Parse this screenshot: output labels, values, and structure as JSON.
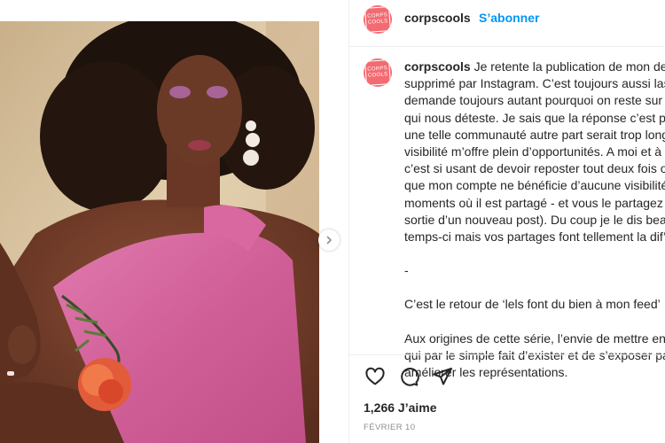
{
  "post": {
    "username": "corpscools",
    "follow_label": "S’abonner",
    "avatar_lines": [
      "CORPS",
      "COOLS"
    ],
    "caption_lines": [
      "Je retente la publication de mon derni",
      "supprimé par Instagram. C’est toujours aussi lassa",
      "demande toujours autant pourquoi on reste sur un",
      "qui nous déteste. Je sais que la réponse c’est parc",
      "une telle communauté autre part serait trop long e",
      "visibilité m’offre plein d’opportunités. A moi et à l’a",
      "c’est si usant de devoir reposter tout deux fois ou c",
      "que mon compte ne bénéficie d’aucune visibilité (",
      "moments où il est partagé - et vous le partagez en",
      "sortie d’un nouveau post). Du coup je le dis beauc",
      "temps-ci mais vos partages font tellement la dif’ ❣️"
    ],
    "separator": "-",
    "paragraph2": "C’est le retour de ‘lels font du bien à mon feed’ 🌷",
    "paragraph3_lines": [
      "Aux origines de cette série, l’envie de mettre en av",
      "qui par le simple fait d’exister et de s’exposer parti",
      "améliorer les représentations."
    ],
    "likes_text": "1,266 J’aime",
    "date_text": "FÉVRIER 10"
  },
  "icons": {
    "like": "heart-outline-icon",
    "comment": "comment-bubble-icon",
    "share": "paper-plane-icon",
    "next": "chevron-right-icon"
  },
  "colors": {
    "accent_blue": "#0095f6",
    "avatar_bg": "#f36b72",
    "swimsuit_pink": "#d9679f",
    "text": "#262626",
    "muted": "#8e8e8e"
  }
}
